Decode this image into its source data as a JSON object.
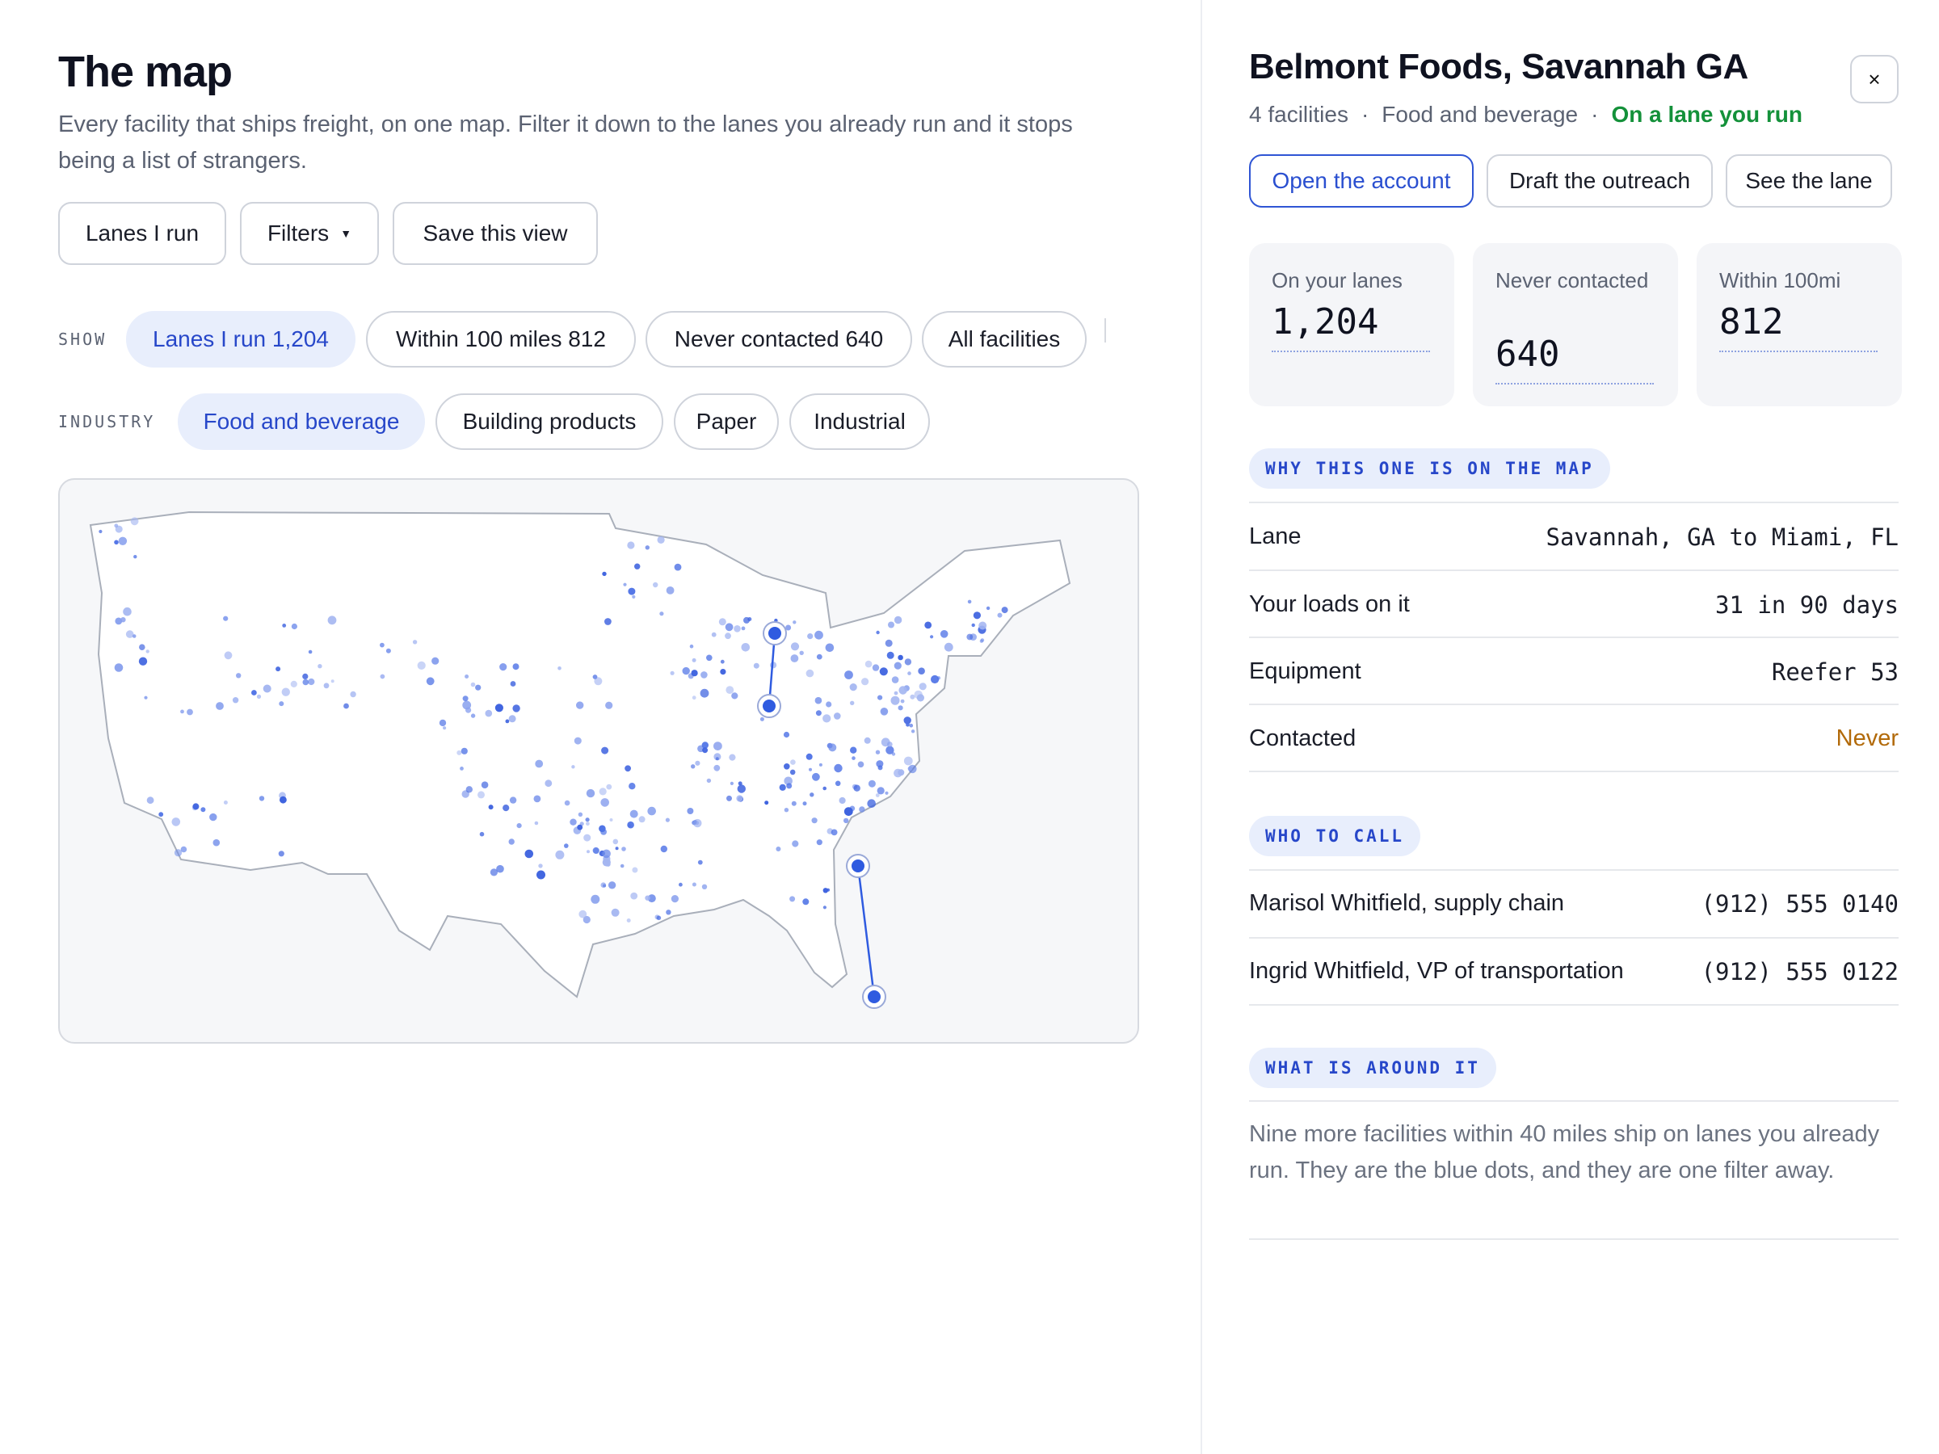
{
  "page": {
    "title": "The map",
    "subtitle": "Every facility that ships freight, on one map. Filter it down to the lanes you already run and it stops being a list of strangers."
  },
  "toolbar": {
    "lanes_label": "Lanes I run",
    "filters_label": "Filters",
    "save_label": "Save this view"
  },
  "show_row": {
    "label": "SHOW",
    "pills": [
      {
        "label": "Lanes I run 1,204",
        "active": true
      },
      {
        "label": "Within 100 miles 812",
        "active": false
      },
      {
        "label": "Never contacted 640",
        "active": false
      },
      {
        "label": "All facilities",
        "active": false
      }
    ]
  },
  "industry_row": {
    "label": "INDUSTRY",
    "pills": [
      {
        "label": "Food and beverage",
        "active": true
      },
      {
        "label": "Building products",
        "active": false
      },
      {
        "label": "Paper",
        "active": false
      },
      {
        "label": "Industrial",
        "active": false
      }
    ]
  },
  "map": {
    "land_color": "#ffffff",
    "border_color": "#a9afba",
    "dot_color": "#4f73e6",
    "lane_color": "#2f5be0"
  },
  "detail": {
    "title": "Belmont Foods, Savannah GA",
    "close_label": "×",
    "meta": {
      "facilities": "4 facilities",
      "industry": "Food and beverage",
      "status": "On a lane you run",
      "separator": "·"
    },
    "actions": {
      "open": "Open the account",
      "draft": "Draft the outreach",
      "lane": "See the lane"
    },
    "stats": [
      {
        "label": "On your lanes",
        "value": "1,204"
      },
      {
        "label": "Never contacted",
        "value": "640"
      },
      {
        "label": "Within 100mi",
        "value": "812"
      }
    ],
    "why": {
      "tag": "WHY THIS ONE IS ON THE MAP",
      "rows": [
        {
          "key": "Lane",
          "value": "Savannah, GA to Miami, FL"
        },
        {
          "key": "Your loads on it",
          "value": "31 in 90 days"
        },
        {
          "key": "Equipment",
          "value": "Reefer 53"
        },
        {
          "key": "Contacted",
          "value": "Never"
        }
      ]
    },
    "who": {
      "tag": "WHO TO CALL",
      "rows": [
        {
          "key": "Marisol Whitfield, supply chain",
          "value": "(912) 555 0140"
        },
        {
          "key": "Ingrid Whitfield, VP of transportation",
          "value": "(912) 555 0122"
        }
      ]
    },
    "around": {
      "tag": "WHAT IS AROUND IT",
      "text": "Nine more facilities within 40 miles ship on lanes you already run. They are the blue dots, and they are one filter away."
    },
    "colors": {
      "accent": "#2747c9",
      "good": "#14913a",
      "warn": "#b26a0a"
    }
  }
}
